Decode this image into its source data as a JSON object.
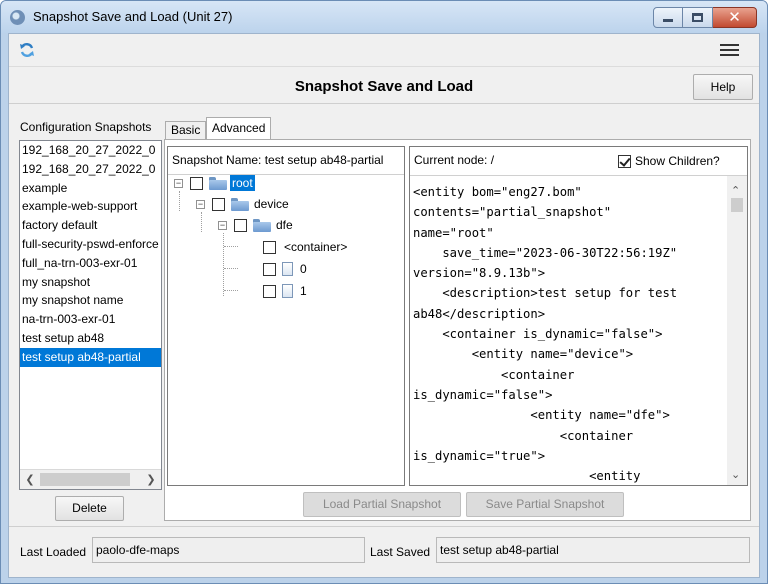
{
  "window": {
    "title": "Snapshot Save and Load (Unit 27)",
    "close_glyph": "✕"
  },
  "header": {
    "title": "Snapshot Save and Load",
    "help_label": "Help"
  },
  "snapshots": {
    "label": "Configuration Snapshots",
    "items": [
      "192_168_20_27_2022_0",
      "192_168_20_27_2022_0",
      "example",
      "example-web-support",
      "factory default",
      "full-security-pswd-enforce",
      "full_na-trn-003-exr-01",
      "my snapshot",
      "my snapshot name",
      "na-trn-003-exr-01",
      "test setup ab48",
      "test setup ab48-partial"
    ],
    "selected_index": 11,
    "delete_label": "Delete"
  },
  "tabs": [
    {
      "label": "Basic",
      "active": false
    },
    {
      "label": "Advanced",
      "active": true
    }
  ],
  "advanced": {
    "snapshot_name_label": "Snapshot Name: test setup ab48-partial",
    "tree": {
      "root": "root",
      "device": "device",
      "dfe": "dfe",
      "container": "<container>",
      "leaf0": "0",
      "leaf1": "1"
    },
    "current_node_label": "Current node: /",
    "show_children_label": "Show Children?",
    "show_children_checked": true,
    "xml_lines": [
      "<entity bom=\"eng27.bom\"",
      "contents=\"partial_snapshot\"",
      "name=\"root\"",
      "    save_time=\"2023-06-30T22:56:19Z\"",
      "version=\"8.9.13b\">",
      "    <description>test setup for test",
      "ab48</description>",
      "    <container is_dynamic=\"false\">",
      "        <entity name=\"device\">",
      "            <container",
      "is_dynamic=\"false\">",
      "                <entity name=\"dfe\">",
      "                    <container",
      "is_dynamic=\"true\">",
      "                        <entity"
    ],
    "load_partial_label": "Load Partial Snapshot",
    "save_partial_label": "Save Partial Snapshot"
  },
  "status": {
    "last_loaded_label": "Last Loaded",
    "last_loaded_value": "paolo-dfe-maps",
    "last_saved_label": "Last Saved",
    "last_saved_value": "test setup ab48-partial"
  },
  "icons": {
    "app": "gear-globe-icon",
    "refresh": "refresh-icon",
    "menu": "hamburger-menu-icon",
    "folder": "folder-icon",
    "file": "file-icon"
  },
  "colors": {
    "selection": "#0078d7",
    "title_bar": "#bcd3ec",
    "close_button": "#c24a31"
  }
}
